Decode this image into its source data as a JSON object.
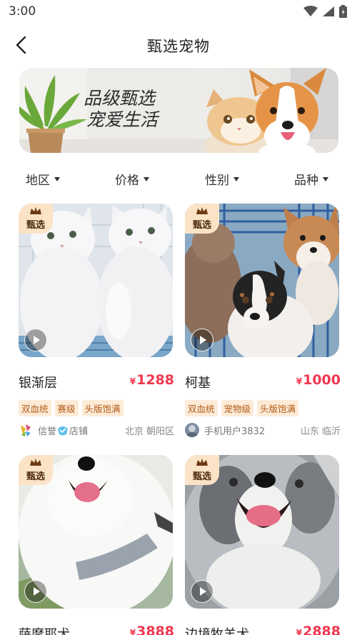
{
  "status": {
    "time": "3:00"
  },
  "nav": {
    "title": "甄选宠物"
  },
  "banner": {
    "line1": "品级甄选",
    "line2": "宠爱生活"
  },
  "filters": [
    {
      "label": "地区"
    },
    {
      "label": "价格"
    },
    {
      "label": "性别"
    },
    {
      "label": "品种"
    }
  ],
  "badge_label": "甄选",
  "cards": [
    {
      "name": "银渐层",
      "price": "1288",
      "currency": "¥",
      "tags": [
        "双血统",
        "赛级",
        "头版饱满"
      ],
      "seller": "信誉",
      "seller_suffix": "店铺",
      "location": "北京 朝阳区"
    },
    {
      "name": "柯基",
      "price": "1000",
      "currency": "¥",
      "tags": [
        "双血统",
        "宠物级",
        "头版饱满"
      ],
      "seller": "手机用户3832",
      "location": "山东 临沂"
    },
    {
      "name": "萨摩耶犬",
      "price": "3888",
      "currency": "¥"
    },
    {
      "name": "边境牧羊犬",
      "price": "2888",
      "currency": "¥"
    }
  ]
}
